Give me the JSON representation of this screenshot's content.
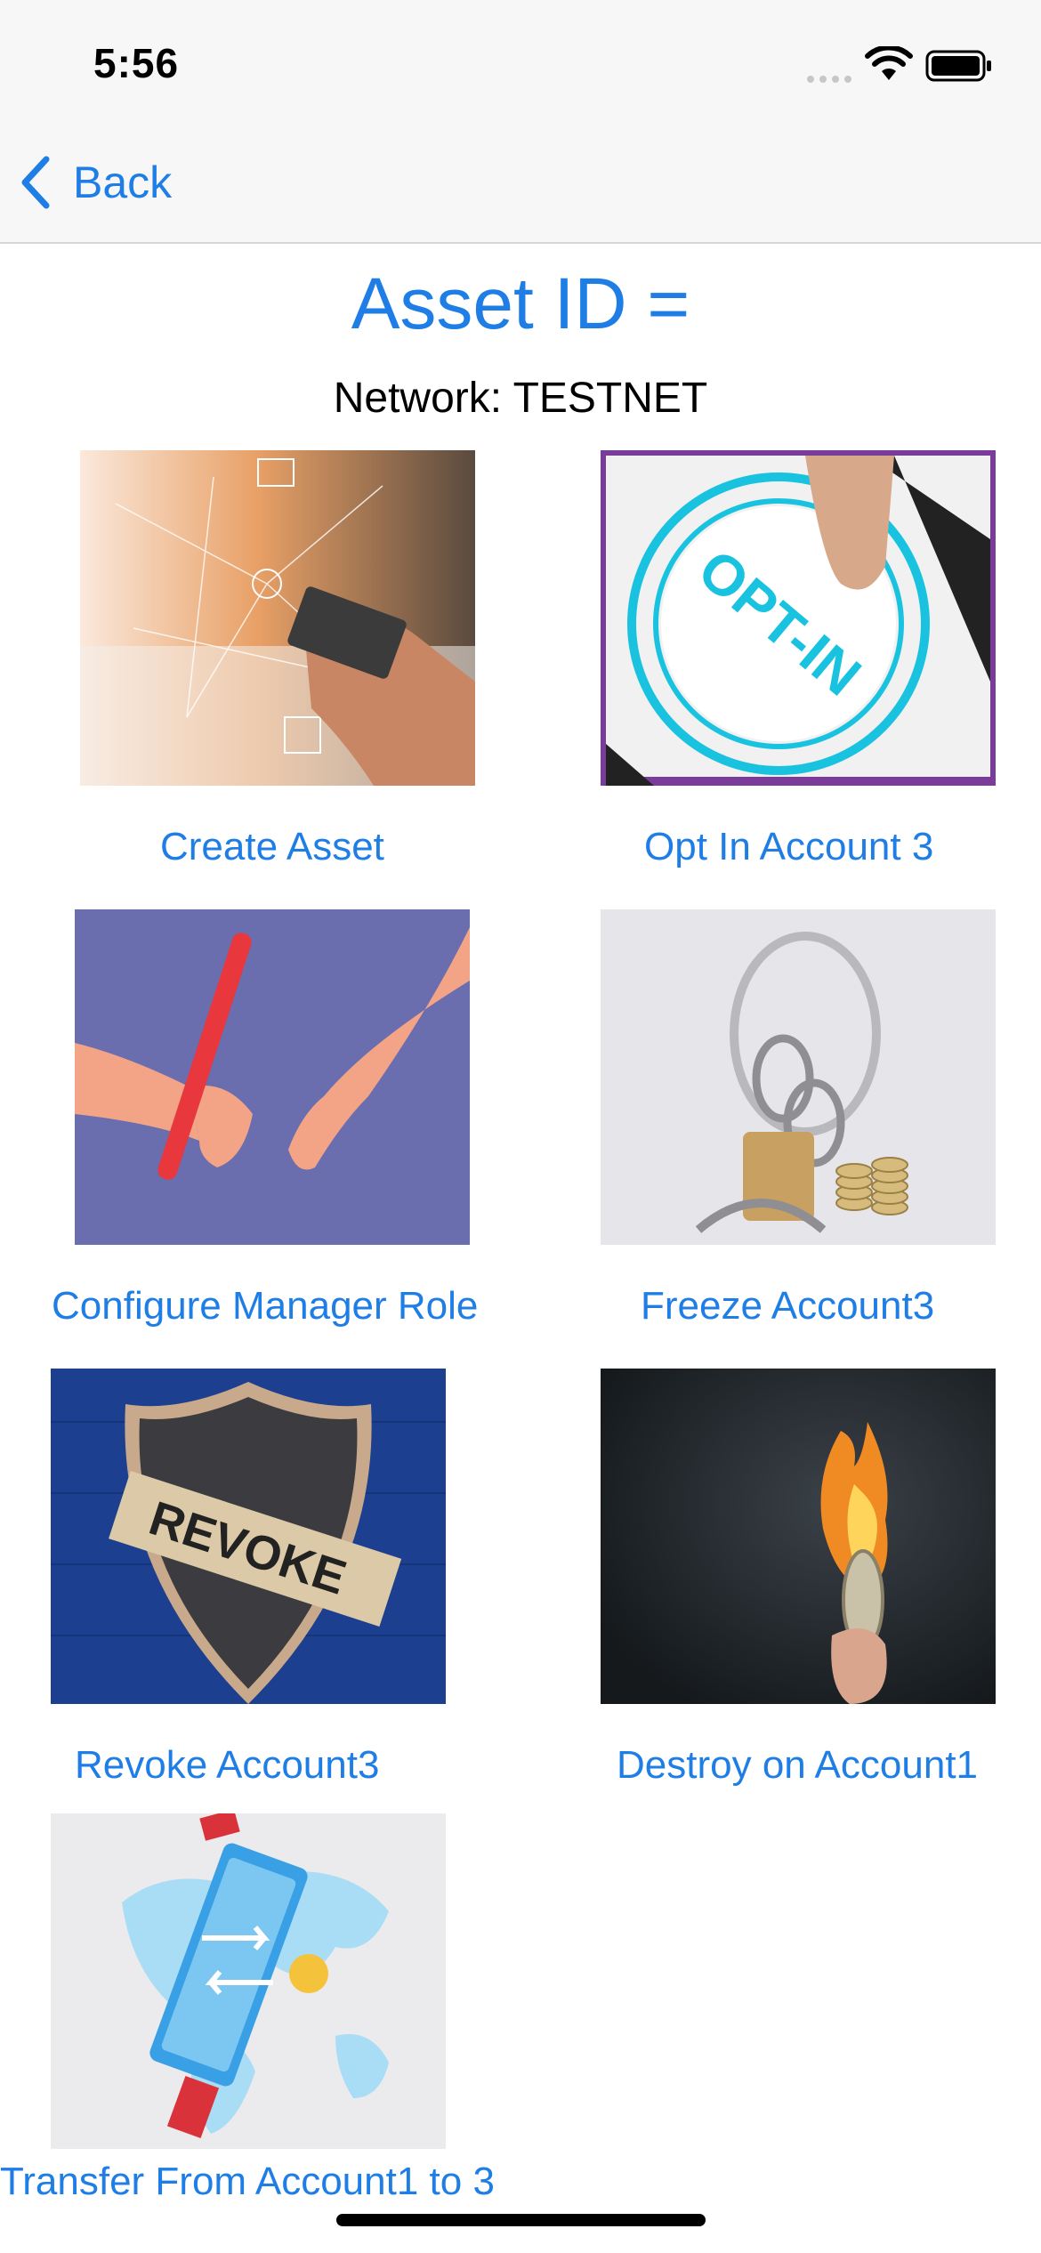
{
  "status_bar": {
    "time": "5:56"
  },
  "nav": {
    "back_label": "Back"
  },
  "header": {
    "title": "Asset ID =",
    "network_text": "Network: TESTNET"
  },
  "tiles": [
    {
      "label": "Create Asset",
      "image": "digital-banking-image"
    },
    {
      "label": "Opt In Account 3",
      "image": "opt-in-button-image",
      "image_text": "OPT-IN"
    },
    {
      "label": "Configure Manager Role",
      "image": "baton-handoff-image"
    },
    {
      "label": "Freeze Account3",
      "image": "chained-coins-image"
    },
    {
      "label": "Revoke Account3",
      "image": "revoke-shield-image",
      "image_text": "REVOKE"
    },
    {
      "label": "Destroy on Account1",
      "image": "burning-coin-image"
    },
    {
      "label": "Transfer From Account1 to 3",
      "image": "transfer-map-image"
    }
  ],
  "colors": {
    "accent": "#1f7ee6",
    "bar_background": "#f7f7f7"
  }
}
